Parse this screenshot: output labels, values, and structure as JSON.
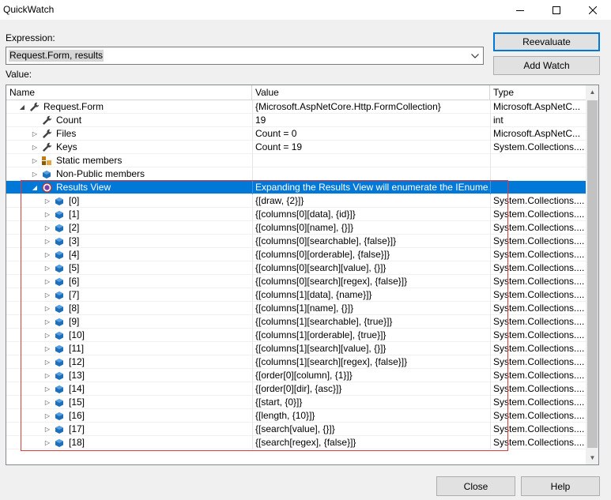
{
  "window": {
    "title": "QuickWatch",
    "minimize_icon": "minimize-icon",
    "maximize_icon": "maximize-icon",
    "close_icon": "close-icon"
  },
  "expression": {
    "label": "Expression:",
    "value": "Request.Form, results"
  },
  "buttons": {
    "reevaluate": "Reevaluate",
    "add_watch": "Add Watch",
    "close": "Close",
    "help": "Help"
  },
  "value_label": "Value:",
  "columns": [
    "Name",
    "Value",
    "Type"
  ],
  "colors": {
    "selection": "#0078d7",
    "highlight_box": "#e0393e"
  },
  "rows": [
    {
      "name": "Request.Form",
      "value": "{Microsoft.AspNetCore.Http.FormCollection}",
      "type": "Microsoft.AspNetC...",
      "level": 0,
      "expander": "expanded",
      "icon": "wrench-icon"
    },
    {
      "name": "Count",
      "value": "19",
      "type": "int",
      "level": 1,
      "expander": "none",
      "icon": "wrench-icon"
    },
    {
      "name": "Files",
      "value": "Count = 0",
      "type": "Microsoft.AspNetC...",
      "level": 1,
      "expander": "collapsed",
      "icon": "wrench-icon"
    },
    {
      "name": "Keys",
      "value": "Count = 19",
      "type": "System.Collections....",
      "level": 1,
      "expander": "collapsed",
      "icon": "wrench-icon"
    },
    {
      "name": "Static members",
      "value": "",
      "type": "",
      "level": 1,
      "expander": "collapsed",
      "icon": "static-members-icon"
    },
    {
      "name": "Non-Public members",
      "value": "",
      "type": "",
      "level": 1,
      "expander": "collapsed",
      "icon": "field-icon"
    },
    {
      "name": "Results View",
      "value": "Expanding the Results View will enumerate the IEnume...",
      "type": "",
      "level": 1,
      "expander": "expanded",
      "icon": "results-view-icon",
      "selected": true
    },
    {
      "name": "[0]",
      "value": "{[draw, {2}]}",
      "type": "System.Collections....",
      "level": 2,
      "expander": "collapsed",
      "icon": "field-icon"
    },
    {
      "name": "[1]",
      "value": "{[columns[0][data], {id}]}",
      "type": "System.Collections....",
      "level": 2,
      "expander": "collapsed",
      "icon": "field-icon"
    },
    {
      "name": "[2]",
      "value": "{[columns[0][name], {}]}",
      "type": "System.Collections....",
      "level": 2,
      "expander": "collapsed",
      "icon": "field-icon"
    },
    {
      "name": "[3]",
      "value": "{[columns[0][searchable], {false}]}",
      "type": "System.Collections....",
      "level": 2,
      "expander": "collapsed",
      "icon": "field-icon"
    },
    {
      "name": "[4]",
      "value": "{[columns[0][orderable], {false}]}",
      "type": "System.Collections....",
      "level": 2,
      "expander": "collapsed",
      "icon": "field-icon"
    },
    {
      "name": "[5]",
      "value": "{[columns[0][search][value], {}]}",
      "type": "System.Collections....",
      "level": 2,
      "expander": "collapsed",
      "icon": "field-icon"
    },
    {
      "name": "[6]",
      "value": "{[columns[0][search][regex], {false}]}",
      "type": "System.Collections....",
      "level": 2,
      "expander": "collapsed",
      "icon": "field-icon"
    },
    {
      "name": "[7]",
      "value": "{[columns[1][data], {name}]}",
      "type": "System.Collections....",
      "level": 2,
      "expander": "collapsed",
      "icon": "field-icon"
    },
    {
      "name": "[8]",
      "value": "{[columns[1][name], {}]}",
      "type": "System.Collections....",
      "level": 2,
      "expander": "collapsed",
      "icon": "field-icon"
    },
    {
      "name": "[9]",
      "value": "{[columns[1][searchable], {true}]}",
      "type": "System.Collections....",
      "level": 2,
      "expander": "collapsed",
      "icon": "field-icon"
    },
    {
      "name": "[10]",
      "value": "{[columns[1][orderable], {true}]}",
      "type": "System.Collections....",
      "level": 2,
      "expander": "collapsed",
      "icon": "field-icon"
    },
    {
      "name": "[11]",
      "value": "{[columns[1][search][value], {}]}",
      "type": "System.Collections....",
      "level": 2,
      "expander": "collapsed",
      "icon": "field-icon"
    },
    {
      "name": "[12]",
      "value": "{[columns[1][search][regex], {false}]}",
      "type": "System.Collections....",
      "level": 2,
      "expander": "collapsed",
      "icon": "field-icon"
    },
    {
      "name": "[13]",
      "value": "{[order[0][column], {1}]}",
      "type": "System.Collections....",
      "level": 2,
      "expander": "collapsed",
      "icon": "field-icon"
    },
    {
      "name": "[14]",
      "value": "{[order[0][dir], {asc}]}",
      "type": "System.Collections....",
      "level": 2,
      "expander": "collapsed",
      "icon": "field-icon"
    },
    {
      "name": "[15]",
      "value": "{[start, {0}]}",
      "type": "System.Collections....",
      "level": 2,
      "expander": "collapsed",
      "icon": "field-icon"
    },
    {
      "name": "[16]",
      "value": "{[length, {10}]}",
      "type": "System.Collections....",
      "level": 2,
      "expander": "collapsed",
      "icon": "field-icon"
    },
    {
      "name": "[17]",
      "value": "{[search[value], {}]}",
      "type": "System.Collections....",
      "level": 2,
      "expander": "collapsed",
      "icon": "field-icon"
    },
    {
      "name": "[18]",
      "value": "{[search[regex], {false}]}",
      "type": "System.Collections....",
      "level": 2,
      "expander": "collapsed",
      "icon": "field-icon"
    }
  ]
}
